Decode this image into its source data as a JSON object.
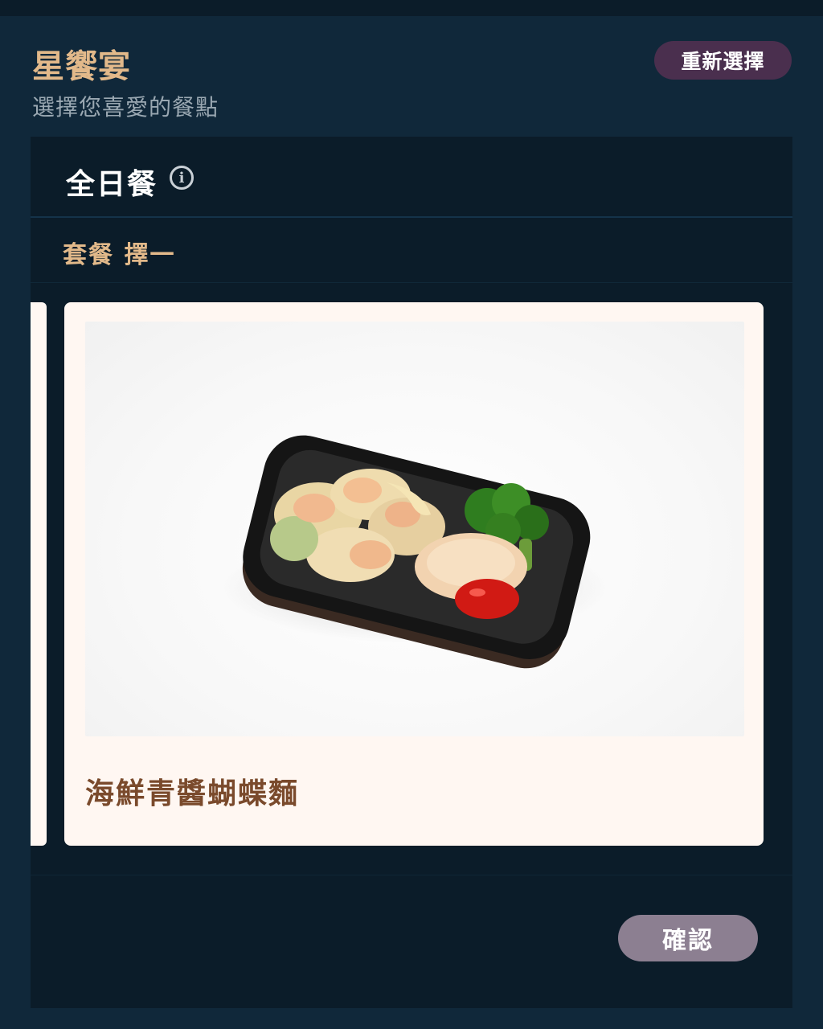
{
  "header": {
    "title": "星饗宴",
    "subtitle": "選擇您喜愛的餐點",
    "reselect_label": "重新選擇"
  },
  "section": {
    "title": "全日餐",
    "info_icon": "info-icon",
    "group_label": "套餐 擇一"
  },
  "card": {
    "name": "海鮮青醬蝴蝶麵",
    "image_description_icon": "meal-tray-image"
  },
  "footer": {
    "confirm_label": "確認"
  },
  "colors": {
    "background": "#10283a",
    "panel": "#0b1c29",
    "accent_gold": "#e2b98a",
    "card_bg": "#fff7f2",
    "card_title": "#7a4a2c",
    "reselect_button": "#4a2f4e",
    "confirm_button": "#8c7f91"
  }
}
